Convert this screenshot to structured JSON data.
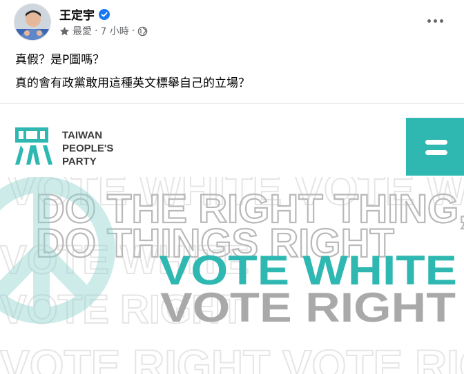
{
  "author": {
    "name": "王定宇",
    "verified": true
  },
  "meta": {
    "audience_icon": "star-icon",
    "audience": "最愛",
    "separator": "·",
    "time": "7 小時",
    "privacy_icon": "globe-icon"
  },
  "post": {
    "line1": "真假？是P圖嗎？",
    "line2": "真的會有政黨敢用這種英文標舉自己的立場？"
  },
  "image": {
    "logo_line1": "TAIWAN",
    "logo_line2": "PEOPLE'S",
    "logo_line3": "PARTY",
    "menu_icon": "hamburger-icon",
    "bg_line1": "VOTE WHITE VOTE WHITE",
    "bg_line2": "DO THE RIGHT THING,",
    "bg_line3": "DO THINGS RIGHT",
    "bg_line4": "VOTE WHITE",
    "bg_line5": "VOTE RIGHT",
    "bg_line6": "VOTE RIGHT  VOTE RIGHT",
    "headline1": "VOTE WHITE",
    "headline2": "VOTE RIGHT"
  },
  "colors": {
    "teal": "#2fb8b2",
    "gray": "#a9a9a9",
    "fb_blue": "#1877f2",
    "meta_gray": "#65676b"
  }
}
